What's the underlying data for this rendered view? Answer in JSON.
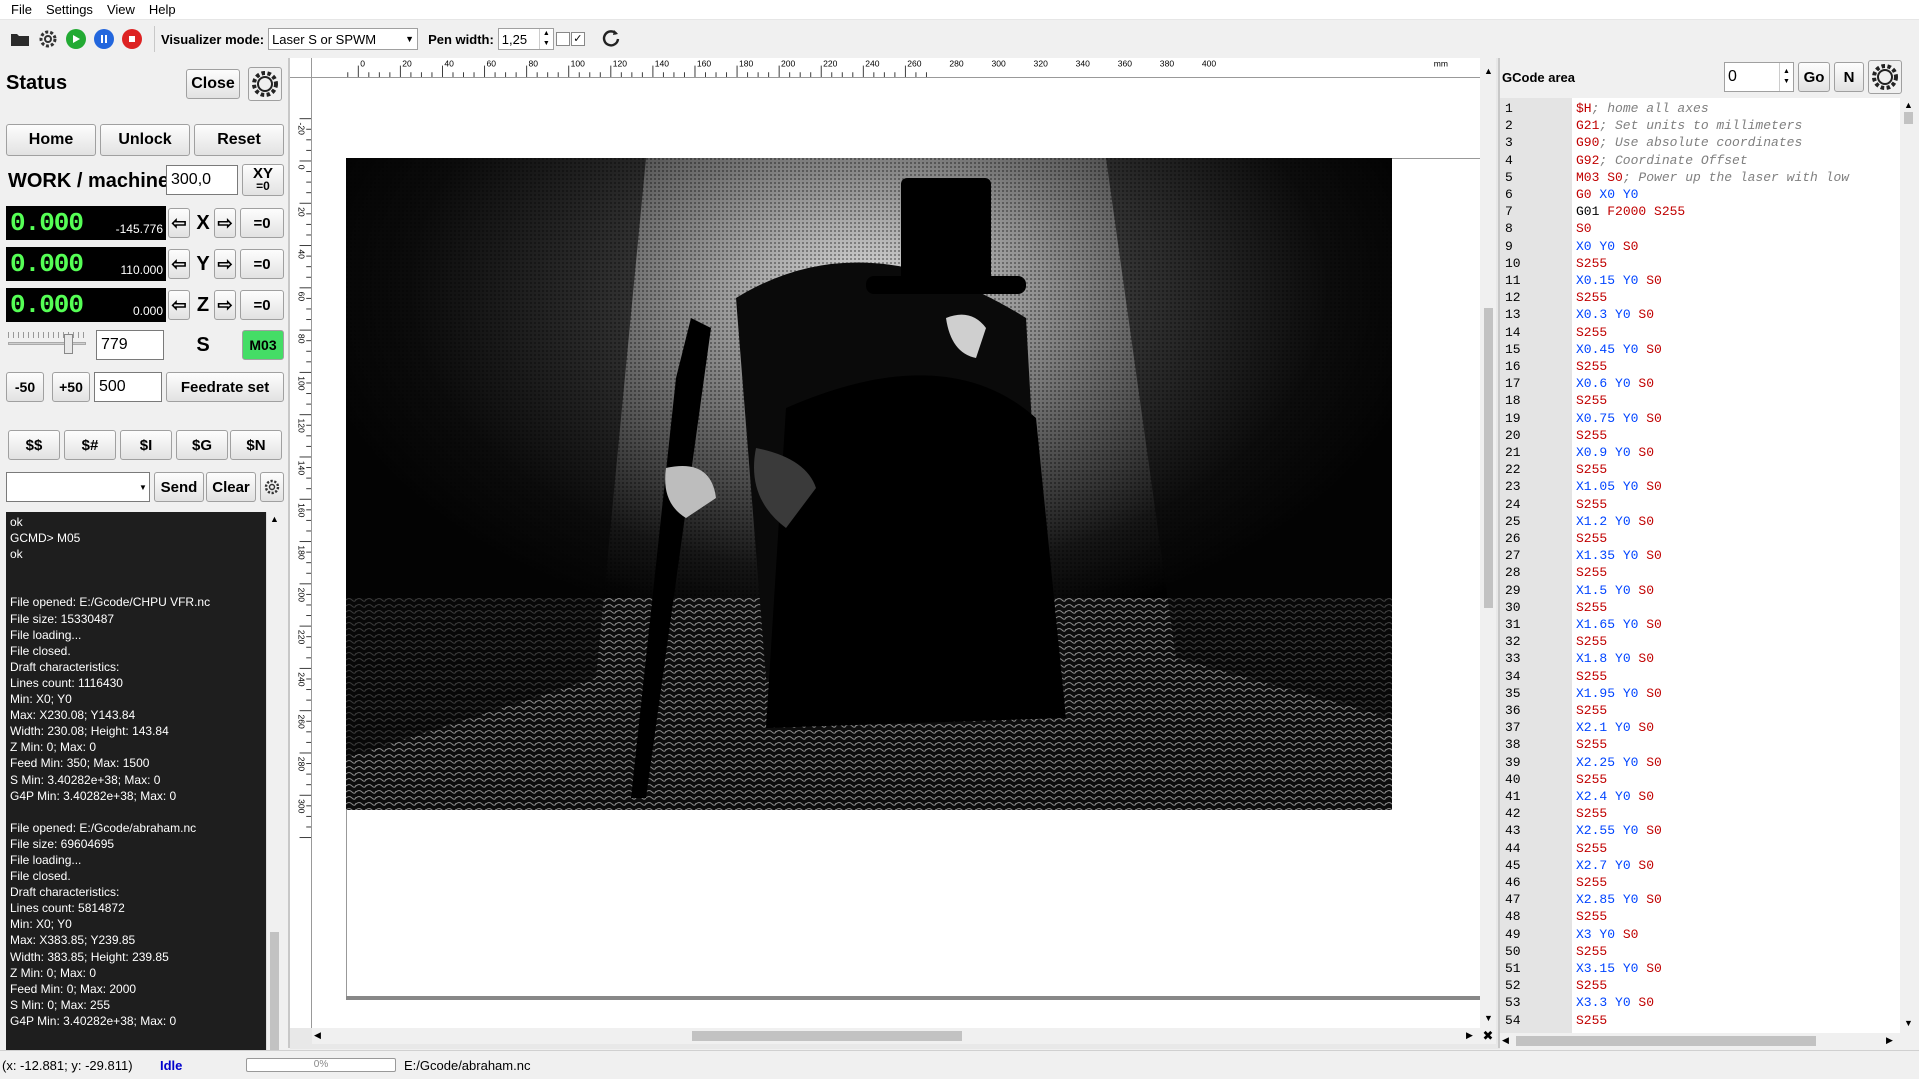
{
  "menu": [
    "File",
    "Settings",
    "View",
    "Help"
  ],
  "toolbar": {
    "vis_mode_label": "Visualizer mode:",
    "vis_mode_value": "Laser S or SPWM",
    "pen_width_label": "Pen width:",
    "pen_width_value": "1,25"
  },
  "status_panel": {
    "title": "Status",
    "close_label": "Close",
    "home_label": "Home",
    "unlock_label": "Unlock",
    "reset_label": "Reset",
    "coord_label": "WORK / machine",
    "coord_input": "300,0",
    "xy_zero_label": "XY",
    "xy_zero_sub": "=0",
    "axes": [
      {
        "name": "X",
        "work": "0.000",
        "machine": "-145.776",
        "zero": "=0"
      },
      {
        "name": "Y",
        "work": "0.000",
        "machine": "110.000",
        "zero": "=0"
      },
      {
        "name": "Z",
        "work": "0.000",
        "machine": "0.000",
        "zero": "=0"
      }
    ],
    "spindle_value": "779",
    "spindle_label": "S",
    "m03_label": "M03",
    "minus50": "-50",
    "plus50": "+50",
    "feed_value": "500",
    "feedrate_set": "Feedrate set",
    "cmds": [
      "$$",
      "$#",
      "$I",
      "$G",
      "$N"
    ],
    "send_label": "Send",
    "clear_label": "Clear"
  },
  "console_lines": [
    "ok",
    "GCMD> M05",
    "ok",
    "",
    "",
    "File opened: E:/Gcode/CHPU VFR.nc",
    "File size: 15330487",
    "File loading...",
    "File closed.",
    "Draft characteristics:",
    "Lines count: 1116430",
    "Min: X0; Y0",
    "Max: X230.08; Y143.84",
    "Width: 230.08; Height: 143.84",
    "Z Min: 0; Max: 0",
    "Feed Min: 350; Max: 1500",
    "S Min: 3.40282e+38; Max: 0",
    "G4P Min: 3.40282e+38; Max: 0",
    "",
    "File opened: E:/Gcode/abraham.nc",
    "File size: 69604695",
    "File loading...",
    "File closed.",
    "Draft characteristics:",
    "Lines count: 5814872",
    "Min: X0; Y0",
    "Max: X383.85; Y239.85",
    "Width: 383.85; Height: 239.85",
    "Z Min: 0; Max: 0",
    "Feed Min: 0; Max: 2000",
    "S Min: 0; Max: 255",
    "G4P Min: 3.40282e+38; Max: 0"
  ],
  "ruler": {
    "unit": "mm",
    "top_ticks": [
      "0",
      "20",
      "40",
      "60",
      "80",
      "100",
      "120",
      "140",
      "160",
      "180",
      "200",
      "220",
      "240",
      "260",
      "280",
      "300",
      "320",
      "340",
      "360",
      "380",
      "400"
    ],
    "left_ticks": [
      "-20",
      "0",
      "20",
      "40",
      "60",
      "80",
      "100",
      "120",
      "140",
      "160",
      "180",
      "200",
      "220",
      "240",
      "260",
      "280",
      "300"
    ]
  },
  "gcode_panel": {
    "title": "GCode area",
    "line_input": "0",
    "go_label": "Go",
    "n_label": "N"
  },
  "gcode_lines": [
    [
      [
        "G",
        "$H"
      ],
      [
        "c",
        "; home all axes"
      ]
    ],
    [
      [
        "G",
        "G21"
      ],
      [
        "c",
        "; Set units to millimeters"
      ]
    ],
    [
      [
        "G",
        "G90"
      ],
      [
        "c",
        "; Use absolute coordinates"
      ]
    ],
    [
      [
        "G",
        "G92"
      ],
      [
        "c",
        "; Coordinate Offset"
      ]
    ],
    [
      [
        "G",
        "M03 "
      ],
      [
        "S",
        "S0"
      ],
      [
        "c",
        "; Power up the laser with low"
      ]
    ],
    [
      [
        "G",
        "G0 "
      ],
      [
        "X",
        "X0 "
      ],
      [
        "X",
        "Y0"
      ]
    ],
    [
      [
        "p",
        "G01 "
      ],
      [
        "F",
        "F2000 "
      ],
      [
        "S",
        "S255"
      ]
    ],
    [
      [
        "S",
        "S0"
      ]
    ],
    [
      [
        "X",
        "X0 "
      ],
      [
        "X",
        "Y0 "
      ],
      [
        "S",
        "S0"
      ]
    ],
    [
      [
        "S",
        "S255"
      ]
    ],
    [
      [
        "X",
        "X0.15 "
      ],
      [
        "X",
        "Y0 "
      ],
      [
        "S",
        "S0"
      ]
    ],
    [
      [
        "S",
        "S255"
      ]
    ],
    [
      [
        "X",
        "X0.3 "
      ],
      [
        "X",
        "Y0 "
      ],
      [
        "S",
        "S0"
      ]
    ],
    [
      [
        "S",
        "S255"
      ]
    ],
    [
      [
        "X",
        "X0.45 "
      ],
      [
        "X",
        "Y0 "
      ],
      [
        "S",
        "S0"
      ]
    ],
    [
      [
        "S",
        "S255"
      ]
    ],
    [
      [
        "X",
        "X0.6 "
      ],
      [
        "X",
        "Y0 "
      ],
      [
        "S",
        "S0"
      ]
    ],
    [
      [
        "S",
        "S255"
      ]
    ],
    [
      [
        "X",
        "X0.75 "
      ],
      [
        "X",
        "Y0 "
      ],
      [
        "S",
        "S0"
      ]
    ],
    [
      [
        "S",
        "S255"
      ]
    ],
    [
      [
        "X",
        "X0.9 "
      ],
      [
        "X",
        "Y0 "
      ],
      [
        "S",
        "S0"
      ]
    ],
    [
      [
        "S",
        "S255"
      ]
    ],
    [
      [
        "X",
        "X1.05 "
      ],
      [
        "X",
        "Y0 "
      ],
      [
        "S",
        "S0"
      ]
    ],
    [
      [
        "S",
        "S255"
      ]
    ],
    [
      [
        "X",
        "X1.2 "
      ],
      [
        "X",
        "Y0 "
      ],
      [
        "S",
        "S0"
      ]
    ],
    [
      [
        "S",
        "S255"
      ]
    ],
    [
      [
        "X",
        "X1.35 "
      ],
      [
        "X",
        "Y0 "
      ],
      [
        "S",
        "S0"
      ]
    ],
    [
      [
        "S",
        "S255"
      ]
    ],
    [
      [
        "X",
        "X1.5 "
      ],
      [
        "X",
        "Y0 "
      ],
      [
        "S",
        "S0"
      ]
    ],
    [
      [
        "S",
        "S255"
      ]
    ],
    [
      [
        "X",
        "X1.65 "
      ],
      [
        "X",
        "Y0 "
      ],
      [
        "S",
        "S0"
      ]
    ],
    [
      [
        "S",
        "S255"
      ]
    ],
    [
      [
        "X",
        "X1.8 "
      ],
      [
        "X",
        "Y0 "
      ],
      [
        "S",
        "S0"
      ]
    ],
    [
      [
        "S",
        "S255"
      ]
    ],
    [
      [
        "X",
        "X1.95 "
      ],
      [
        "X",
        "Y0 "
      ],
      [
        "S",
        "S0"
      ]
    ],
    [
      [
        "S",
        "S255"
      ]
    ],
    [
      [
        "X",
        "X2.1 "
      ],
      [
        "X",
        "Y0 "
      ],
      [
        "S",
        "S0"
      ]
    ],
    [
      [
        "S",
        "S255"
      ]
    ],
    [
      [
        "X",
        "X2.25 "
      ],
      [
        "X",
        "Y0 "
      ],
      [
        "S",
        "S0"
      ]
    ],
    [
      [
        "S",
        "S255"
      ]
    ],
    [
      [
        "X",
        "X2.4 "
      ],
      [
        "X",
        "Y0 "
      ],
      [
        "S",
        "S0"
      ]
    ],
    [
      [
        "S",
        "S255"
      ]
    ],
    [
      [
        "X",
        "X2.55 "
      ],
      [
        "X",
        "Y0 "
      ],
      [
        "S",
        "S0"
      ]
    ],
    [
      [
        "S",
        "S255"
      ]
    ],
    [
      [
        "X",
        "X2.7 "
      ],
      [
        "X",
        "Y0 "
      ],
      [
        "S",
        "S0"
      ]
    ],
    [
      [
        "S",
        "S255"
      ]
    ],
    [
      [
        "X",
        "X2.85 "
      ],
      [
        "X",
        "Y0 "
      ],
      [
        "S",
        "S0"
      ]
    ],
    [
      [
        "S",
        "S255"
      ]
    ],
    [
      [
        "X",
        "X3 "
      ],
      [
        "X",
        "Y0 "
      ],
      [
        "S",
        "S0"
      ]
    ],
    [
      [
        "S",
        "S255"
      ]
    ],
    [
      [
        "X",
        "X3.15 "
      ],
      [
        "X",
        "Y0 "
      ],
      [
        "S",
        "S0"
      ]
    ],
    [
      [
        "S",
        "S255"
      ]
    ],
    [
      [
        "X",
        "X3.3 "
      ],
      [
        "X",
        "Y0 "
      ],
      [
        "S",
        "S0"
      ]
    ],
    [
      [
        "S",
        "S255"
      ]
    ]
  ],
  "statusbar": {
    "coords": "(x: -12.881; y: -29.811)",
    "state": "Idle",
    "progress": "0%",
    "progress_fraction": 0,
    "file": "E:/Gcode/abraham.nc"
  },
  "colors": {
    "dro_green": "#55ff55",
    "m03_bg": "#44dd66",
    "state_blue": "#0000cc"
  }
}
